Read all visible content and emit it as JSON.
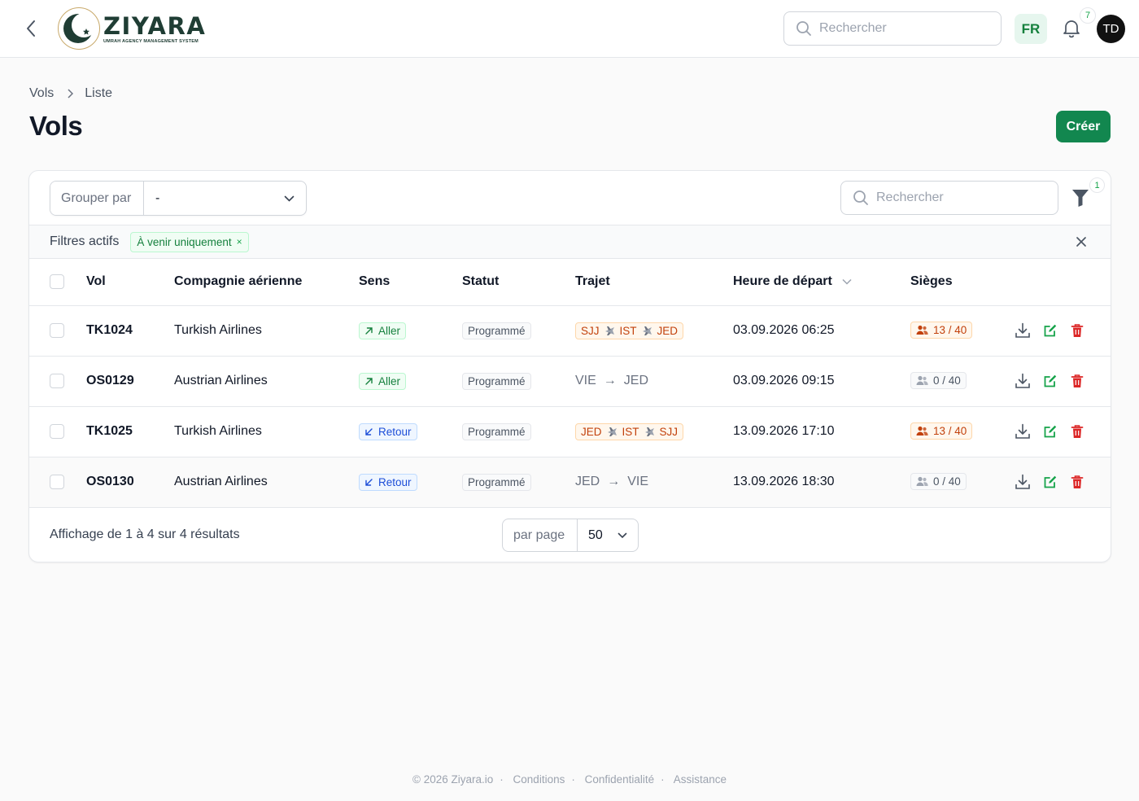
{
  "brand": {
    "name": "ZIYARA",
    "tagline": "UMRAH AGENCY MANAGEMENT SYSTEM",
    "primary_color": "#12874f"
  },
  "topbar": {
    "search_placeholder": "Rechercher",
    "language": "FR",
    "notifications_count": "7",
    "user_initials": "TD"
  },
  "breadcrumb": {
    "root": "Vols",
    "current": "Liste"
  },
  "page": {
    "title": "Vols",
    "create_label": "Créer"
  },
  "toolbar": {
    "group_by_label": "Grouper par",
    "group_by_value": "-",
    "search_placeholder": "Rechercher",
    "filter_count": "1"
  },
  "active_filters": {
    "label": "Filtres actifs",
    "chips": [
      {
        "label": "À venir uniquement"
      }
    ]
  },
  "table": {
    "columns": {
      "vol": "Vol",
      "airline": "Compagnie aérienne",
      "direction": "Sens",
      "status": "Statut",
      "route": "Trajet",
      "departure": "Heure de départ",
      "seats": "Sièges"
    },
    "rows": [
      {
        "vol": "TK1024",
        "airline": "Turkish Airlines",
        "direction": "Aller",
        "direction_type": "aller",
        "status": "Programmé",
        "route_stops": [
          "SJJ",
          "IST",
          "JED"
        ],
        "route_style": "stops",
        "departure": "03.09.2026 06:25",
        "seats": "13 / 40",
        "seats_style": "orange"
      },
      {
        "vol": "OS0129",
        "airline": "Austrian Airlines",
        "direction": "Aller",
        "direction_type": "aller",
        "status": "Programmé",
        "route_stops": [
          "VIE",
          "JED"
        ],
        "route_style": "plain",
        "departure": "03.09.2026 09:15",
        "seats": "0 / 40",
        "seats_style": "grey"
      },
      {
        "vol": "TK1025",
        "airline": "Turkish Airlines",
        "direction": "Retour",
        "direction_type": "retour",
        "status": "Programmé",
        "route_stops": [
          "JED",
          "IST",
          "SJJ"
        ],
        "route_style": "stops",
        "departure": "13.09.2026 17:10",
        "seats": "13 / 40",
        "seats_style": "orange"
      },
      {
        "vol": "OS0130",
        "airline": "Austrian Airlines",
        "direction": "Retour",
        "direction_type": "retour",
        "status": "Programmé",
        "route_stops": [
          "JED",
          "VIE"
        ],
        "route_style": "plain",
        "departure": "13.09.2026 18:30",
        "seats": "0 / 40",
        "seats_style": "grey"
      }
    ]
  },
  "pagination": {
    "summary": "Affichage de 1 à 4 sur 4 résultats",
    "per_page_label": "par page",
    "per_page_value": "50"
  },
  "footer": {
    "copyright": "© 2026 Ziyara.io",
    "links": [
      "Conditions",
      "Confidentialité",
      "Assistance"
    ]
  }
}
